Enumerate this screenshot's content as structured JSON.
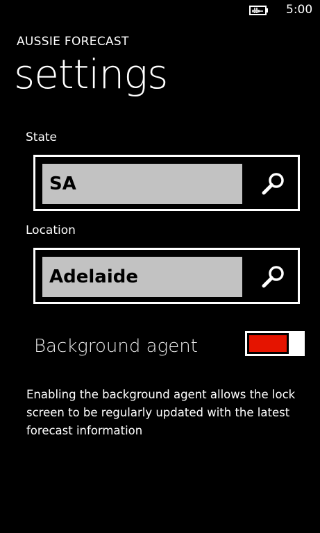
{
  "status_bar": {
    "time": "5:00",
    "battery_icon": "battery-charging-icon"
  },
  "app": {
    "title": "AUSSIE FORECAST",
    "page_title": "settings"
  },
  "state_field": {
    "label": "State",
    "value": "SA",
    "search_icon": "search-icon"
  },
  "location_field": {
    "label": "Location",
    "value": "Adelaide",
    "search_icon": "search-icon"
  },
  "background_agent": {
    "label": "Background agent",
    "enabled": true,
    "accent_color": "#e51400"
  },
  "description": "Enabling the background agent allows the lock screen to be regularly updated with the latest forecast information"
}
